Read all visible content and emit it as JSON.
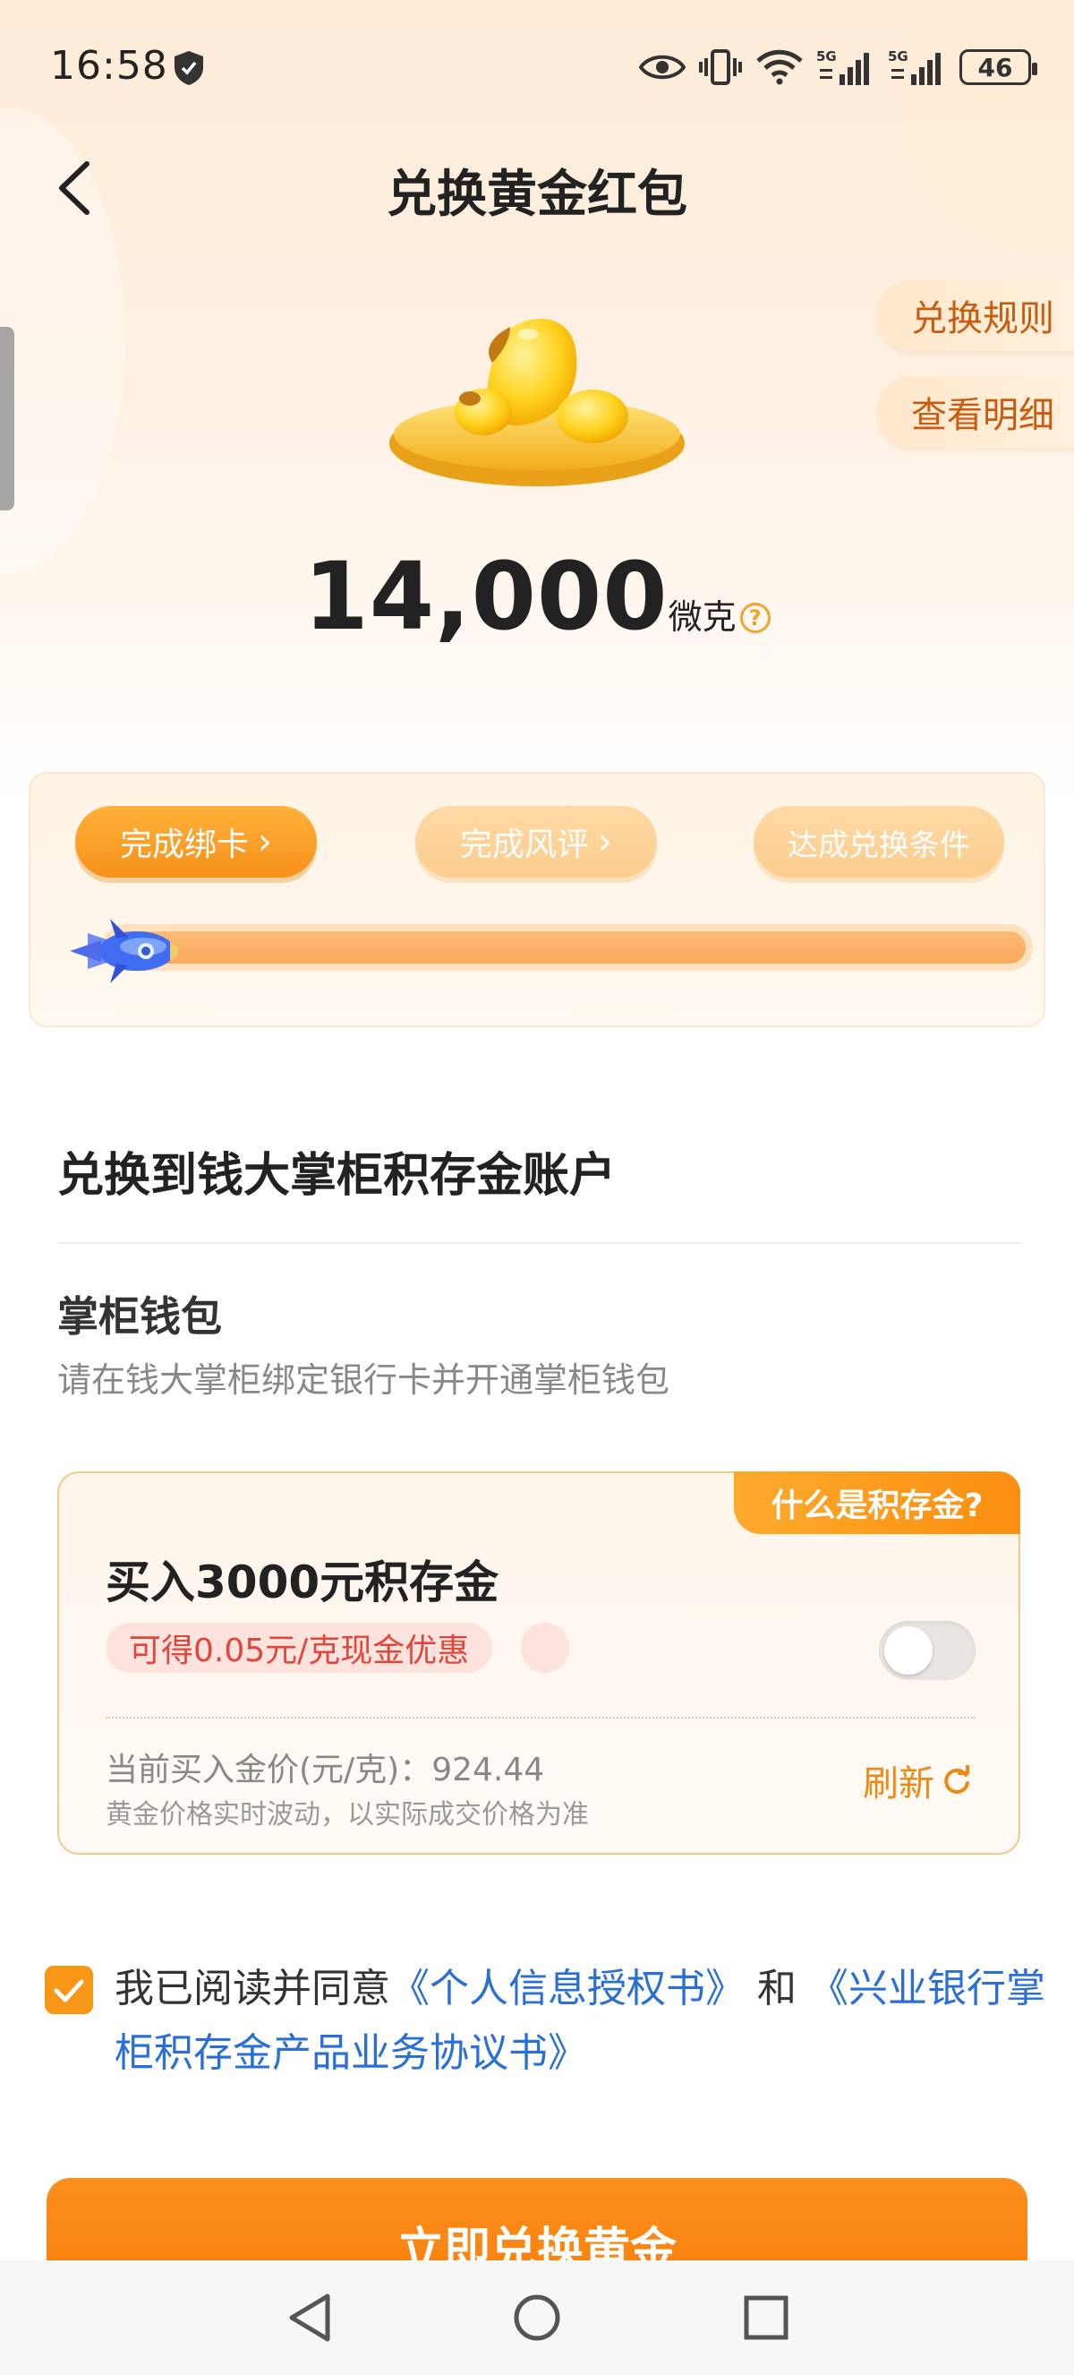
{
  "status_bar": {
    "time": "16:58",
    "battery": "46",
    "network_1": "5G",
    "network_2": "5G"
  },
  "header": {
    "title": "兑换黄金红包",
    "rules_label": "兑换规则",
    "detail_label": "查看明细"
  },
  "gold": {
    "amount": "14,000",
    "unit": "微克",
    "help": "?"
  },
  "progress": {
    "steps": [
      {
        "label": "完成绑卡",
        "chevron": "›"
      },
      {
        "label": "完成风评",
        "chevron": "›"
      },
      {
        "label": "达成兑换条件"
      }
    ]
  },
  "account": {
    "section_title": "兑换到钱大掌柜积存金账户",
    "wallet_title": "掌柜钱包",
    "wallet_desc": "请在钱大掌柜绑定银行卡并开通掌柜钱包"
  },
  "offer": {
    "corner_tag": "什么是积存金?",
    "title": "买入3000元积存金",
    "discount": "可得0.05元/克现金优惠",
    "toggle_on": false,
    "price_line": "当前买入金价(元/克)：924.44",
    "price_note": "黄金价格实时波动，以实际成交价格为准",
    "refresh_label": "刷新"
  },
  "agreement": {
    "checked": true,
    "prefix": "我已阅读并同意",
    "link_1": "《个人信息授权书》",
    "connector": "和",
    "link_2": "《兴业银行掌柜积存金产品业务协议书》"
  },
  "confirm_label": "立即兑换黄金",
  "colors": {
    "accent": "#f98b14",
    "link": "#2a6fd6",
    "discount_text": "#e3453b"
  }
}
